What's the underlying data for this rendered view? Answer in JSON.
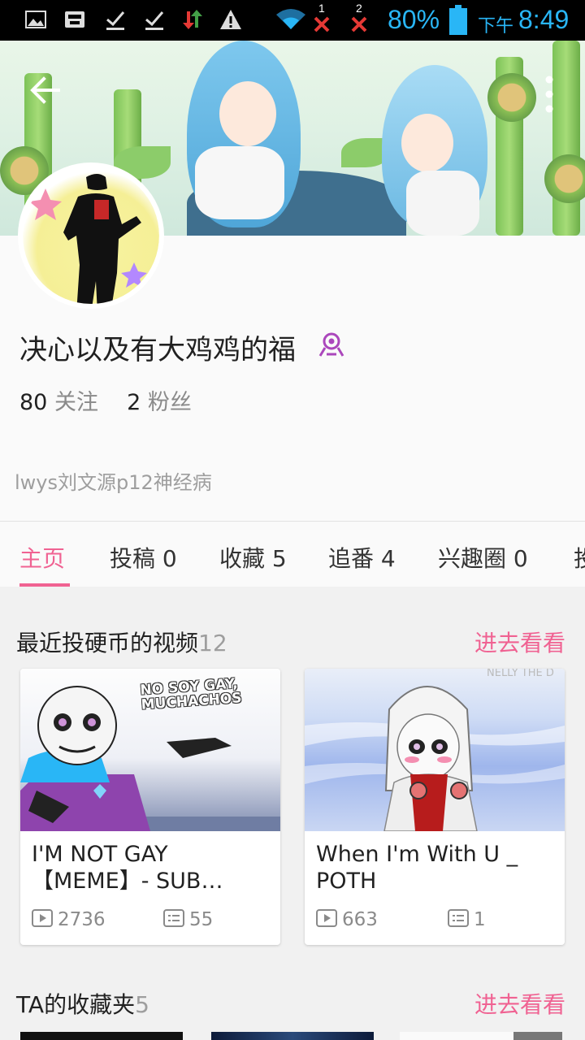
{
  "status_bar": {
    "notif_1": "1",
    "notif_2": "2",
    "battery": "80%",
    "ampm": "下午",
    "time": "8:49"
  },
  "profile": {
    "nickname": "决心以及有大鸡鸡的福",
    "following_count": "80",
    "following_label": "关注",
    "followers_count": "2",
    "followers_label": "粉丝",
    "signature": "lwys刘文源p12神经病"
  },
  "tabs": [
    {
      "label": "主页"
    },
    {
      "label": "投稿 0"
    },
    {
      "label": "收藏 5"
    },
    {
      "label": "追番 4"
    },
    {
      "label": "兴趣圈 0"
    },
    {
      "label": "投"
    }
  ],
  "coin_section": {
    "title": "最近投硬币的视频",
    "count": "12",
    "more": "进去看看"
  },
  "videos": [
    {
      "thumb_caption": "NO SOY GAY, MUCHACHOS",
      "title": "I'M NOT GAY 【MEME】- SUB…",
      "plays": "2736",
      "danmaku": "55"
    },
    {
      "thumb_caption": "NELLY THE D",
      "title": "When I'm With U _ POTH",
      "plays": "663",
      "danmaku": "1"
    }
  ],
  "fav_section": {
    "title": "TA的收藏夹",
    "count": "5",
    "more": "进去看看"
  },
  "colors": {
    "accent": "#f06292",
    "status_blue": "#29b6f6"
  },
  "icons": [
    "back-arrow-icon",
    "more-vert-icon",
    "badge-icon",
    "play-icon",
    "danmaku-icon"
  ]
}
